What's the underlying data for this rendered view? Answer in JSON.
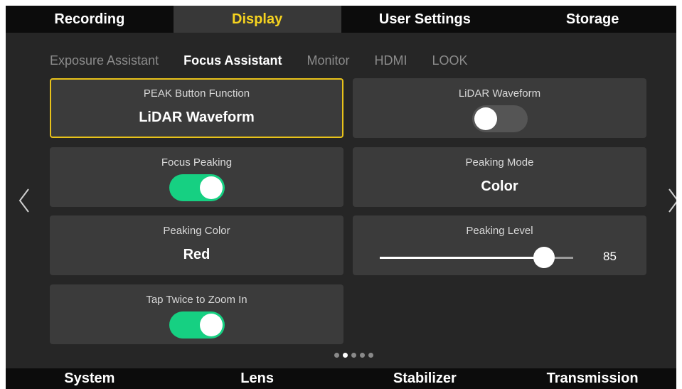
{
  "top_tabs": {
    "items": [
      "Recording",
      "Display",
      "User Settings",
      "Storage"
    ],
    "active": "Display"
  },
  "sub_tabs": {
    "items": [
      "Exposure Assistant",
      "Focus Assistant",
      "Monitor",
      "HDMI",
      "LOOK"
    ],
    "active": "Focus Assistant"
  },
  "settings": {
    "peak_button": {
      "label": "PEAK Button Function",
      "value": "LiDAR Waveform"
    },
    "lidar_waveform": {
      "label": "LiDAR Waveform",
      "toggle": "off"
    },
    "focus_peaking": {
      "label": "Focus Peaking",
      "toggle": "on"
    },
    "peaking_mode": {
      "label": "Peaking Mode",
      "value": "Color"
    },
    "peaking_color": {
      "label": "Peaking Color",
      "value": "Red"
    },
    "peaking_level": {
      "label": "Peaking Level",
      "value": "85",
      "fraction": 0.85
    },
    "tap_twice_zoom": {
      "label": "Tap Twice to Zoom In",
      "toggle": "on"
    }
  },
  "pagination": {
    "pages": 5,
    "current": 2
  },
  "bottom_tabs": {
    "items": [
      "System",
      "Lens",
      "Stabilizer",
      "Transmission"
    ]
  },
  "icons": {
    "prev": "chevron-left-icon",
    "next": "chevron-right-icon"
  },
  "colors": {
    "accent": "#f6d31f",
    "toggle_on": "#16d082",
    "selected_border": "#e8c21a"
  }
}
